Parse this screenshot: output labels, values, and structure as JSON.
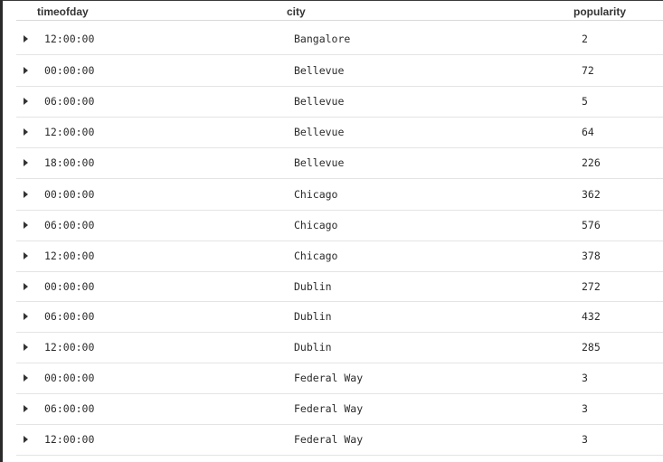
{
  "columns": {
    "time": "timeofday",
    "city": "city",
    "popularity": "popularity"
  },
  "rows": [
    {
      "time": "12:00:00",
      "city": "Bangalore",
      "popularity": "2"
    },
    {
      "time": "00:00:00",
      "city": "Bellevue",
      "popularity": "72"
    },
    {
      "time": "06:00:00",
      "city": "Bellevue",
      "popularity": "5"
    },
    {
      "time": "12:00:00",
      "city": "Bellevue",
      "popularity": "64"
    },
    {
      "time": "18:00:00",
      "city": "Bellevue",
      "popularity": "226"
    },
    {
      "time": "00:00:00",
      "city": "Chicago",
      "popularity": "362"
    },
    {
      "time": "06:00:00",
      "city": "Chicago",
      "popularity": "576"
    },
    {
      "time": "12:00:00",
      "city": "Chicago",
      "popularity": "378"
    },
    {
      "time": "00:00:00",
      "city": "Dublin",
      "popularity": "272"
    },
    {
      "time": "06:00:00",
      "city": "Dublin",
      "popularity": "432"
    },
    {
      "time": "12:00:00",
      "city": "Dublin",
      "popularity": "285"
    },
    {
      "time": "00:00:00",
      "city": "Federal Way",
      "popularity": "3"
    },
    {
      "time": "06:00:00",
      "city": "Federal Way",
      "popularity": "3"
    },
    {
      "time": "12:00:00",
      "city": "Federal Way",
      "popularity": "3"
    }
  ]
}
